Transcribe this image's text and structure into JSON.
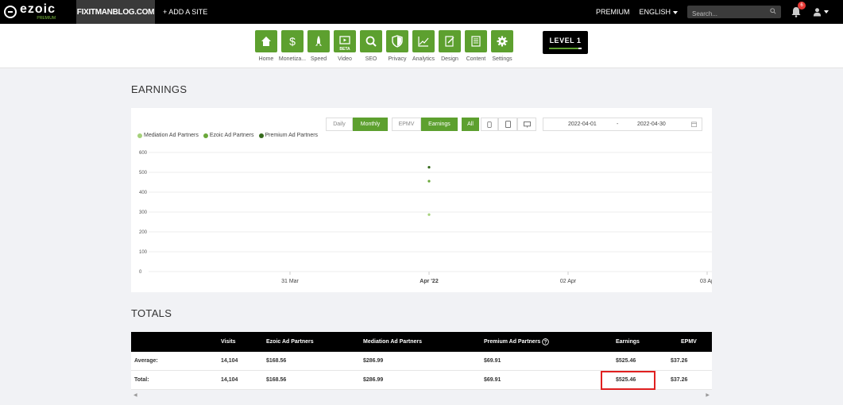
{
  "topbar": {
    "logo_word": "ezoic",
    "logo_sub": "PREMIUM",
    "site": "FIXITMANBLOG.COM",
    "add_site": "+ ADD A SITE",
    "premium": "PREMIUM",
    "language": "ENGLISH",
    "search_placeholder": "Search...",
    "notification_count": "6"
  },
  "nav": [
    {
      "label": "Home",
      "icon": "home-icon"
    },
    {
      "label": "Monetiza...",
      "icon": "dollar-icon"
    },
    {
      "label": "Speed",
      "icon": "rocket-icon"
    },
    {
      "label": "Video",
      "icon": "video-icon",
      "badge": "BETA"
    },
    {
      "label": "SEO",
      "icon": "magnifier-icon"
    },
    {
      "label": "Privacy",
      "icon": "shield-icon"
    },
    {
      "label": "Analytics",
      "icon": "line-chart-icon"
    },
    {
      "label": "Design",
      "icon": "design-icon"
    },
    {
      "label": "Content",
      "icon": "document-icon"
    },
    {
      "label": "Settings",
      "icon": "gear-icon"
    }
  ],
  "level": {
    "label": "LEVEL 1",
    "progress": 0.9
  },
  "earnings": {
    "title": "EARNINGS",
    "period_daily": "Daily",
    "period_monthly": "Monthly",
    "metric_epmv": "EPMV",
    "metric_earnings": "Earnings",
    "device_all": "All",
    "date_start": "2022-04-01",
    "date_separator": "-",
    "date_end": "2022-04-30"
  },
  "chart_data": {
    "type": "scatter",
    "legend": [
      "Mediation Ad Partners",
      "Ezoic Ad Partners",
      "Premium Ad Partners"
    ],
    "series": [
      {
        "name": "Mediation Ad Partners",
        "color": "#a5d17a",
        "points": [
          {
            "x": "Apr '22",
            "y": 286.99
          }
        ]
      },
      {
        "name": "Ezoic Ad Partners",
        "color": "#6aa83a",
        "points": [
          {
            "x": "Apr '22",
            "y": 455.55
          }
        ]
      },
      {
        "name": "Premium Ad Partners",
        "color": "#356a1c",
        "points": [
          {
            "x": "Apr '22",
            "y": 525.46
          }
        ]
      }
    ],
    "y_ticks": [
      "600",
      "500",
      "400",
      "300",
      "200",
      "100",
      "0"
    ],
    "x_ticks": [
      "31 Mar",
      "Apr '22",
      "02 Apr",
      "03 Ap"
    ],
    "ylim": [
      0,
      600
    ],
    "grid": true,
    "legend_position": "top-left"
  },
  "totals": {
    "title": "TOTALS",
    "columns": [
      "",
      "Visits",
      "Ezoic Ad Partners",
      "Mediation Ad Partners",
      "Premium Ad Partners",
      "Earnings",
      "EPMV"
    ],
    "rows": [
      [
        "Average:",
        "14,104",
        "$168.56",
        "$286.99",
        "$69.91",
        "$525.46",
        "$37.26"
      ],
      [
        "Total:",
        "14,104",
        "$168.56",
        "$286.99",
        "$69.91",
        "$525.46",
        "$37.26"
      ]
    ]
  }
}
